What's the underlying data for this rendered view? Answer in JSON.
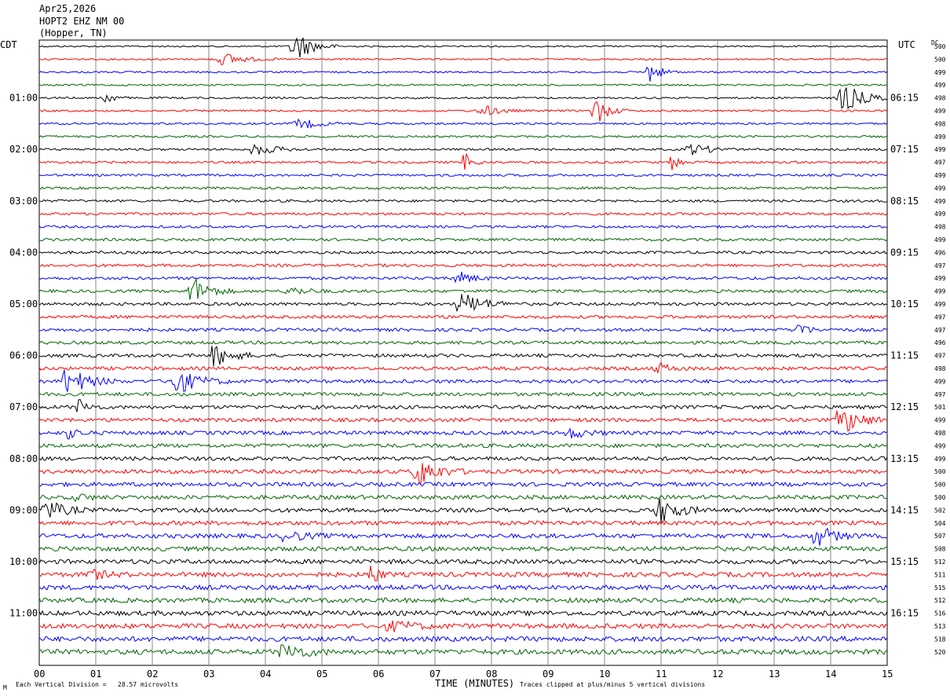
{
  "header": {
    "date": "Apr25,2026",
    "station": "HOPT2 EHZ NM 00",
    "location": "(Hopper, TN)"
  },
  "left_zone": "CDT",
  "right_zone": "UTC",
  "dc_label": "DC",
  "footer": {
    "scale": "Each Vertical Division =   28.57 microvolts",
    "xlabel": "TIME (MINUTES)",
    "clip_note": "Traces clipped at plus/minus 5 vertical divisions",
    "corner_mark": "M"
  },
  "chart_data": {
    "type": "line",
    "plot_kind": "helicorder",
    "xlabel": "TIME (MINUTES)",
    "xlim": [
      0,
      15
    ],
    "x_ticks": [
      "00",
      "01",
      "02",
      "03",
      "04",
      "05",
      "06",
      "07",
      "08",
      "09",
      "10",
      "11",
      "12",
      "13",
      "14",
      "15"
    ],
    "trace_colors": [
      "#000000",
      "#ff0000",
      "#0000ff",
      "#006400"
    ],
    "trace_count": 48,
    "left_hour_labels": [
      "01:00",
      "02:00",
      "03:00",
      "04:00",
      "05:00",
      "06:00",
      "07:00",
      "08:00",
      "09:00",
      "10:00",
      "11:00"
    ],
    "right_hour_labels": [
      "06:15",
      "07:15",
      "08:15",
      "09:15",
      "10:15",
      "11:15",
      "12:15",
      "13:15",
      "14:15",
      "15:15",
      "16:15"
    ],
    "dc_offsets": [
      500,
      500,
      499,
      499,
      498,
      499,
      498,
      499,
      499,
      497,
      499,
      499,
      499,
      499,
      498,
      499,
      496,
      497,
      499,
      499,
      499,
      497,
      497,
      496,
      497,
      498,
      499,
      497,
      501,
      499,
      498,
      499,
      499,
      500,
      500,
      500,
      502,
      504,
      507,
      508,
      512,
      511,
      515,
      512,
      516,
      513,
      518,
      520
    ],
    "grid": true
  }
}
